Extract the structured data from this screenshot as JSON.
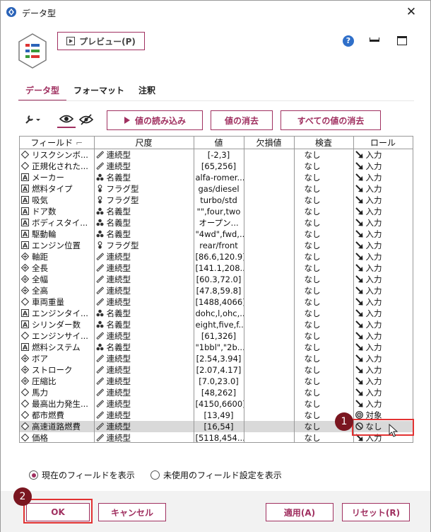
{
  "window": {
    "title": "データ型",
    "close_glyph": "✕"
  },
  "toolbar": {
    "preview_label": "プレビュー(P)",
    "help_glyph": "?"
  },
  "tabs": [
    {
      "label": "データ型",
      "active": true
    },
    {
      "label": "フォーマット",
      "active": false
    },
    {
      "label": "注釈",
      "active": false
    }
  ],
  "actions": {
    "read_values": "値の読み込み",
    "clear_values": "値の消去",
    "clear_all": "すべての値の消去"
  },
  "columns": [
    "フィールド",
    "尺度",
    "値",
    "欠損値",
    "検査",
    "ロール"
  ],
  "rows": [
    {
      "type_icon": "diamond",
      "field": "リスクシンボ...",
      "measure_icon": "ruler",
      "measure": "連続型",
      "values": "[-2,3]",
      "missing": "",
      "check": "なし",
      "role_icon": "input-arrow",
      "role": "入力"
    },
    {
      "type_icon": "diamond",
      "field": "正規化された...",
      "measure_icon": "ruler",
      "measure": "連続型",
      "values": "[65,256]",
      "missing": "",
      "check": "なし",
      "role_icon": "input-arrow",
      "role": "入力"
    },
    {
      "type_icon": "a-box",
      "field": "メーカー",
      "measure_icon": "nominal",
      "measure": "名義型",
      "values": "alfa-romer...",
      "missing": "",
      "check": "なし",
      "role_icon": "input-arrow",
      "role": "入力"
    },
    {
      "type_icon": "a-box",
      "field": "燃料タイプ",
      "measure_icon": "flag",
      "measure": "フラグ型",
      "values": "gas/diesel",
      "missing": "",
      "check": "なし",
      "role_icon": "input-arrow",
      "role": "入力"
    },
    {
      "type_icon": "a-box",
      "field": "吸気",
      "measure_icon": "flag",
      "measure": "フラグ型",
      "values": "turbo/std",
      "missing": "",
      "check": "なし",
      "role_icon": "input-arrow",
      "role": "入力"
    },
    {
      "type_icon": "a-box",
      "field": "ドア数",
      "measure_icon": "nominal",
      "measure": "名義型",
      "values": "\"\",four,two",
      "missing": "",
      "check": "なし",
      "role_icon": "input-arrow",
      "role": "入力"
    },
    {
      "type_icon": "a-box",
      "field": "ボディスタイ...",
      "measure_icon": "nominal",
      "measure": "名義型",
      "values": "オープン...",
      "missing": "",
      "check": "なし",
      "role_icon": "input-arrow",
      "role": "入力"
    },
    {
      "type_icon": "a-box",
      "field": "駆動輪",
      "measure_icon": "nominal",
      "measure": "名義型",
      "values": "\"4wd\",fwd,...",
      "missing": "",
      "check": "なし",
      "role_icon": "input-arrow",
      "role": "入力"
    },
    {
      "type_icon": "a-box",
      "field": "エンジン位置",
      "measure_icon": "flag",
      "measure": "フラグ型",
      "values": "rear/front",
      "missing": "",
      "check": "なし",
      "role_icon": "input-arrow",
      "role": "入力"
    },
    {
      "type_icon": "real",
      "field": "軸距",
      "measure_icon": "ruler",
      "measure": "連続型",
      "values": "[86.6,120.9]",
      "missing": "",
      "check": "なし",
      "role_icon": "input-arrow",
      "role": "入力"
    },
    {
      "type_icon": "real",
      "field": "全長",
      "measure_icon": "ruler",
      "measure": "連続型",
      "values": "[141.1,208...",
      "missing": "",
      "check": "なし",
      "role_icon": "input-arrow",
      "role": "入力"
    },
    {
      "type_icon": "real",
      "field": "全幅",
      "measure_icon": "ruler",
      "measure": "連続型",
      "values": "[60.3,72.0]",
      "missing": "",
      "check": "なし",
      "role_icon": "input-arrow",
      "role": "入力"
    },
    {
      "type_icon": "real",
      "field": "全高",
      "measure_icon": "ruler",
      "measure": "連続型",
      "values": "[47.8,59.8]",
      "missing": "",
      "check": "なし",
      "role_icon": "input-arrow",
      "role": "入力"
    },
    {
      "type_icon": "diamond",
      "field": "車両重量",
      "measure_icon": "ruler",
      "measure": "連続型",
      "values": "[1488,4066]",
      "missing": "",
      "check": "なし",
      "role_icon": "input-arrow",
      "role": "入力"
    },
    {
      "type_icon": "a-box",
      "field": "エンジンタイ...",
      "measure_icon": "nominal",
      "measure": "名義型",
      "values": "dohc,l,ohc,...",
      "missing": "",
      "check": "なし",
      "role_icon": "input-arrow",
      "role": "入力"
    },
    {
      "type_icon": "a-box",
      "field": "シリンダー数",
      "measure_icon": "nominal",
      "measure": "名義型",
      "values": "eight,five,f...",
      "missing": "",
      "check": "なし",
      "role_icon": "input-arrow",
      "role": "入力"
    },
    {
      "type_icon": "diamond",
      "field": "エンジンサイ...",
      "measure_icon": "ruler",
      "measure": "連続型",
      "values": "[61,326]",
      "missing": "",
      "check": "なし",
      "role_icon": "input-arrow",
      "role": "入力"
    },
    {
      "type_icon": "a-box",
      "field": "燃料システム",
      "measure_icon": "nominal",
      "measure": "名義型",
      "values": "\"1bbl\",\"2b...",
      "missing": "",
      "check": "なし",
      "role_icon": "input-arrow",
      "role": "入力"
    },
    {
      "type_icon": "real",
      "field": "ボア",
      "measure_icon": "ruler",
      "measure": "連続型",
      "values": "[2.54,3.94]",
      "missing": "",
      "check": "なし",
      "role_icon": "input-arrow",
      "role": "入力"
    },
    {
      "type_icon": "real",
      "field": "ストローク",
      "measure_icon": "ruler",
      "measure": "連続型",
      "values": "[2.07,4.17]",
      "missing": "",
      "check": "なし",
      "role_icon": "input-arrow",
      "role": "入力"
    },
    {
      "type_icon": "real",
      "field": "圧縮比",
      "measure_icon": "ruler",
      "measure": "連続型",
      "values": "[7.0,23.0]",
      "missing": "",
      "check": "なし",
      "role_icon": "input-arrow",
      "role": "入力"
    },
    {
      "type_icon": "diamond",
      "field": "馬力",
      "measure_icon": "ruler",
      "measure": "連続型",
      "values": "[48,262]",
      "missing": "",
      "check": "なし",
      "role_icon": "input-arrow",
      "role": "入力"
    },
    {
      "type_icon": "diamond",
      "field": "最高出力発生...",
      "measure_icon": "ruler",
      "measure": "連続型",
      "values": "[4150,6600]",
      "missing": "",
      "check": "なし",
      "role_icon": "input-arrow",
      "role": "入力"
    },
    {
      "type_icon": "diamond",
      "field": "都市燃費",
      "measure_icon": "ruler",
      "measure": "連続型",
      "values": "[13,49]",
      "missing": "",
      "check": "なし",
      "role_icon": "target",
      "role": "対象"
    },
    {
      "type_icon": "diamond",
      "field": "高速道路燃費",
      "measure_icon": "ruler",
      "measure": "連続型",
      "values": "[16,54]",
      "missing": "",
      "check": "なし",
      "role_icon": "none",
      "role": "なし",
      "selected": true
    },
    {
      "type_icon": "diamond",
      "field": "価格",
      "measure_icon": "ruler",
      "measure": "連続型",
      "values": "[5118,454...",
      "missing": "",
      "check": "なし",
      "role_icon": "input-arrow",
      "role": "入力"
    }
  ],
  "display_options": {
    "current_fields": "現在のフィールドを表示",
    "unused_settings": "未使用のフィールド設定を表示",
    "selected": "current_fields"
  },
  "buttons": {
    "ok": "OK",
    "cancel": "キャンセル",
    "apply": "適用(A)",
    "reset": "リセット(R)"
  },
  "annotations": {
    "badge1": "1",
    "badge2": "2"
  },
  "colors": {
    "accent": "#a03060",
    "highlight": "#e23232",
    "badge": "#7a1620"
  }
}
